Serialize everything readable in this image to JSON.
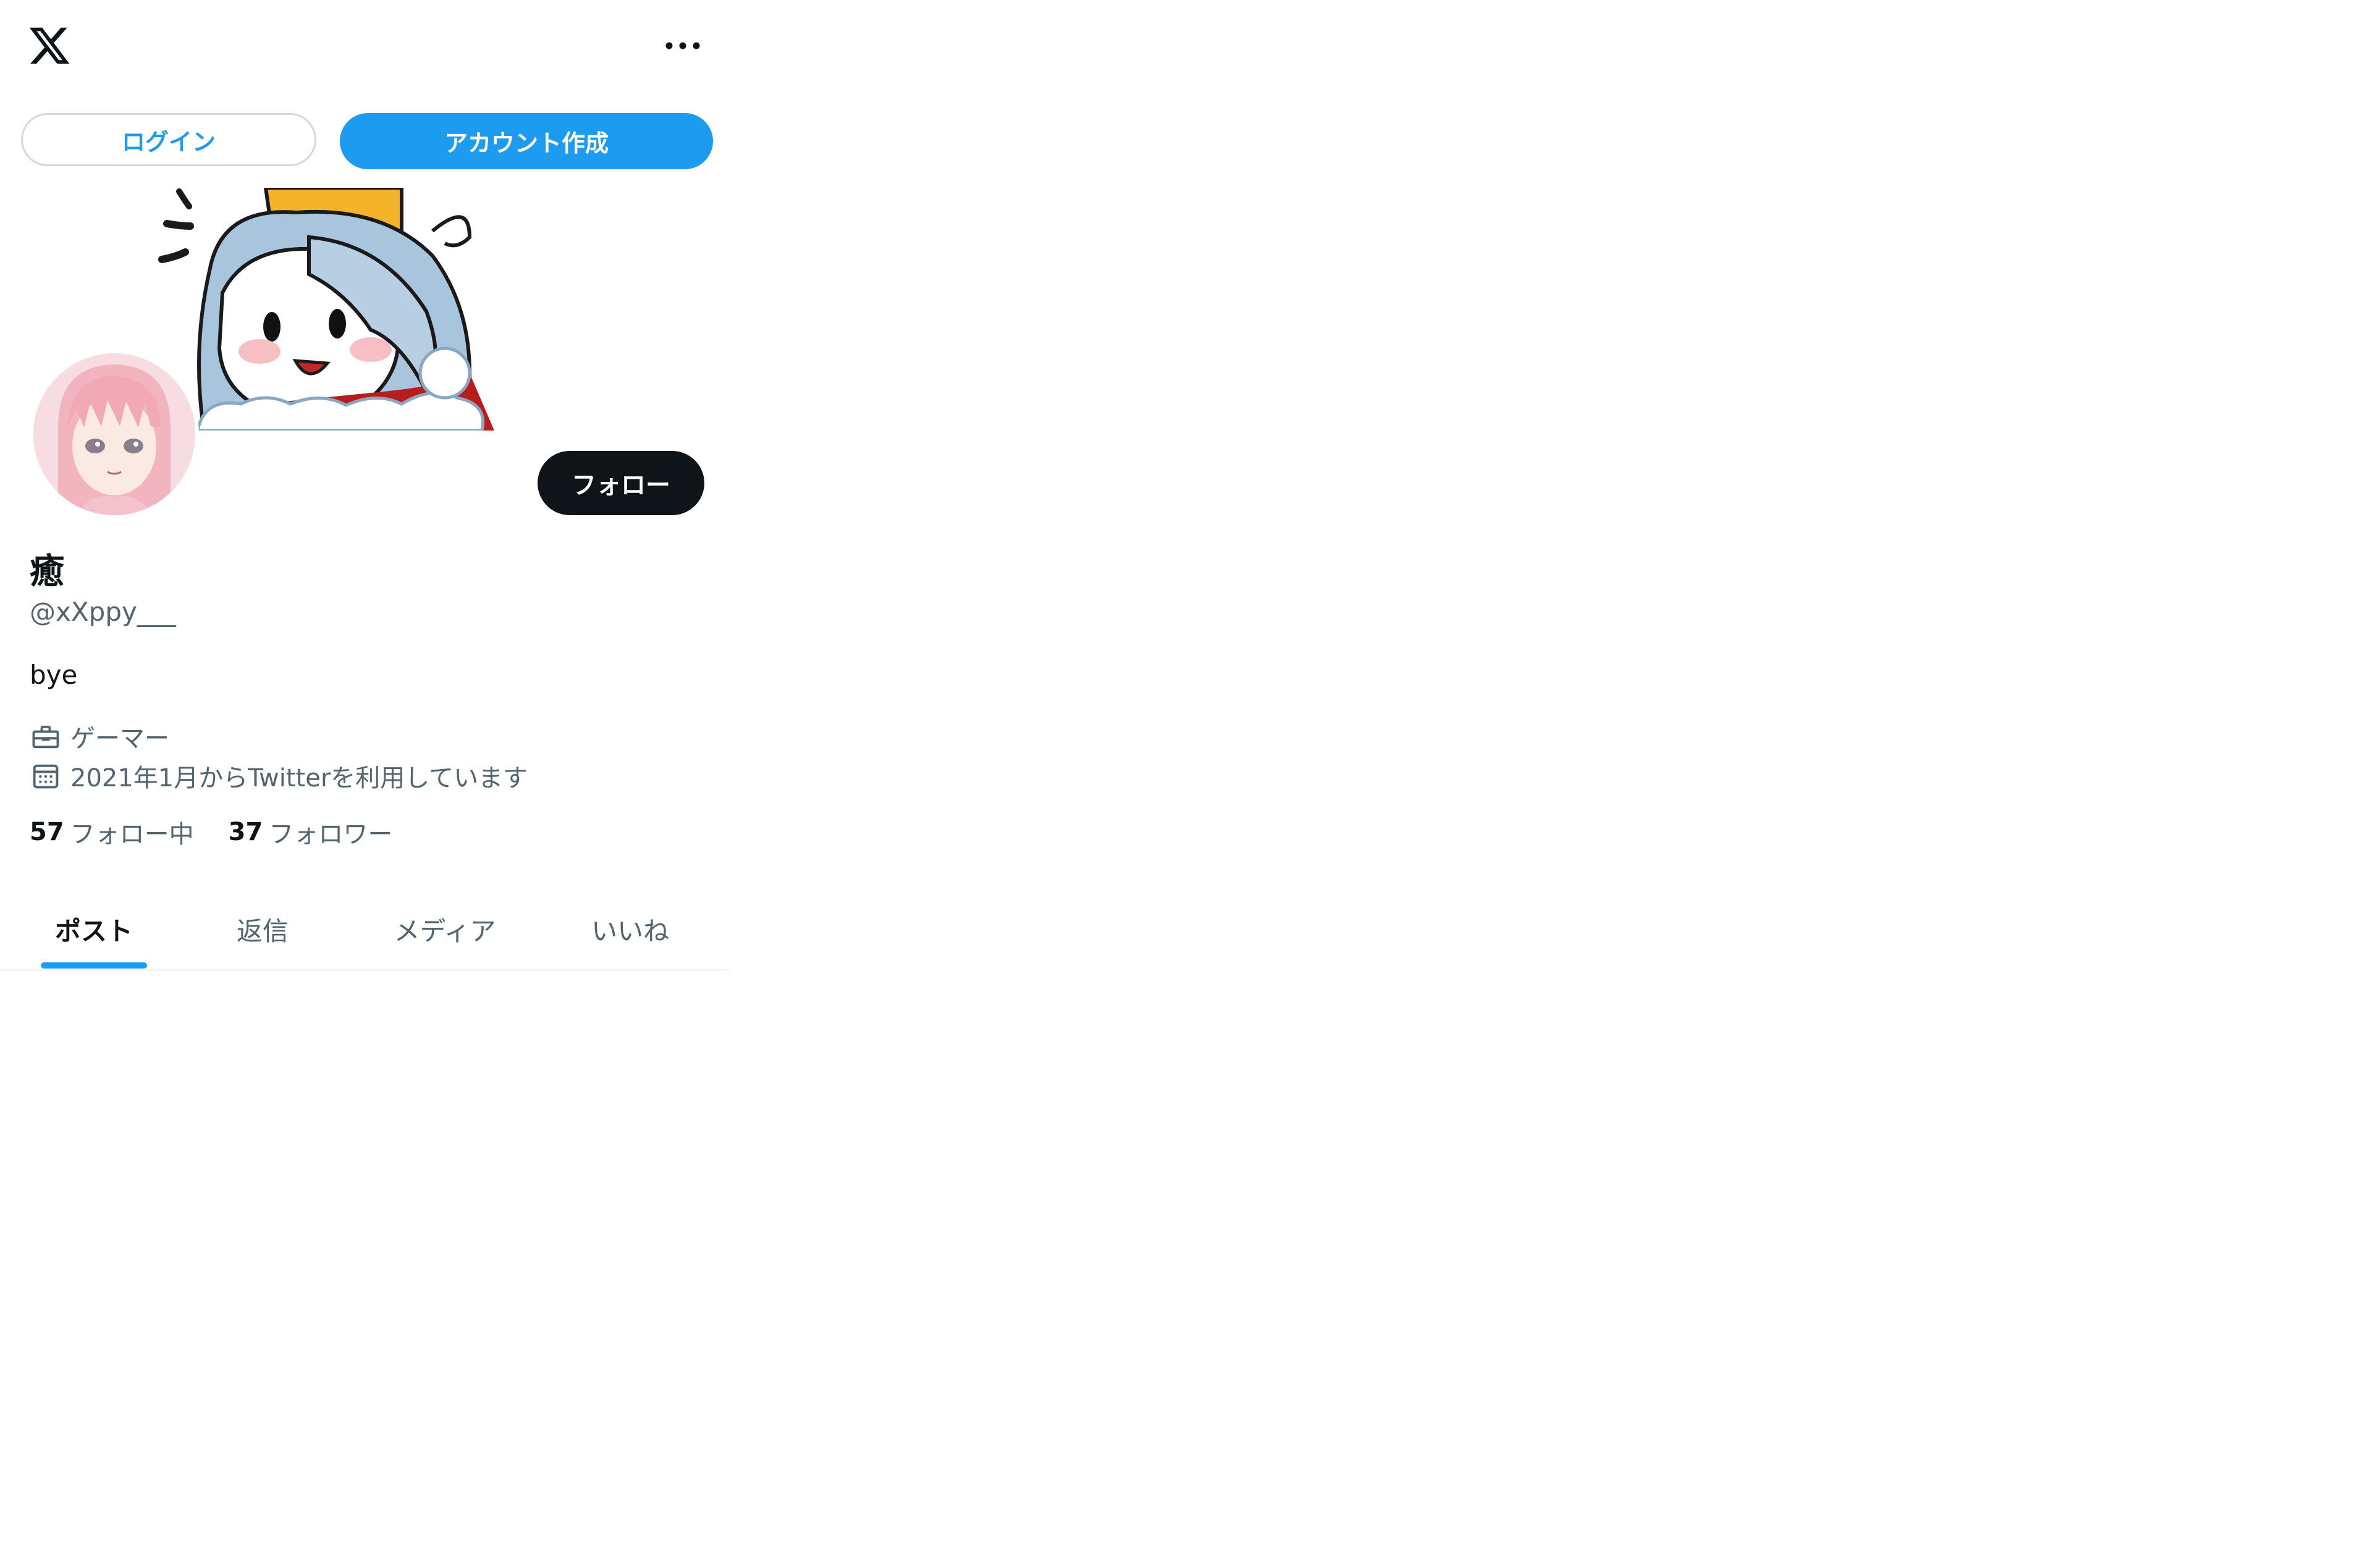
{
  "header": {
    "logo_icon": "x-logo-icon",
    "more_icon": "more-horizontal-icon"
  },
  "auth": {
    "login_label": "ログイン",
    "signup_label": "アカウント作成"
  },
  "profile": {
    "display_name": "癒",
    "handle": "@xXppy___",
    "bio": "bye",
    "category": "ゲーマー",
    "joined": "2021年1月からTwitterを利用しています",
    "follow_label": "フォロー",
    "following_count": "57",
    "following_label": "フォロー中",
    "followers_count": "37",
    "followers_label": "フォロワー"
  },
  "tabs": [
    {
      "label": "ポスト",
      "active": true
    },
    {
      "label": "返信",
      "active": false
    },
    {
      "label": "メディア",
      "active": false
    },
    {
      "label": "いいね",
      "active": false
    }
  ],
  "colors": {
    "accent": "#1d9bf0",
    "text_primary": "#0f1419",
    "text_secondary": "#536471",
    "border": "#cfd9de"
  }
}
